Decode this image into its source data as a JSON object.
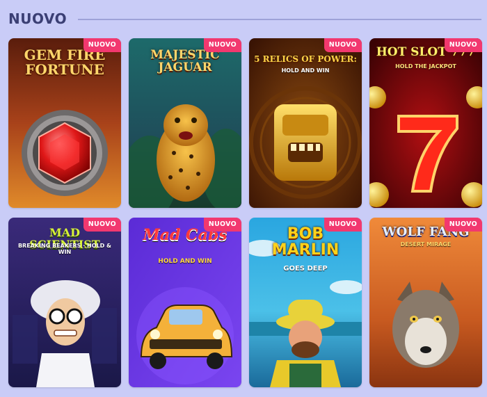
{
  "section": {
    "title": "NUOVO"
  },
  "badge_label": "NUOVO",
  "games": [
    {
      "title": "GEM FIRE FORTUNE",
      "subtitle": ""
    },
    {
      "title": "MAJESTIC JAGUAR",
      "subtitle": ""
    },
    {
      "title": "5 RELICS OF POWER:",
      "subtitle": "HOLD AND WIN"
    },
    {
      "title": "HOT SLOT 777",
      "subtitle": "HOLD THE JACKPOT"
    },
    {
      "title": "MAD SCIENTIST",
      "subtitle": "BREAKING BEAKERS · HOLD & WIN"
    },
    {
      "title": "Mad Cabs",
      "subtitle": "HOLD AND WIN"
    },
    {
      "title": "BOB MARLIN",
      "subtitle": "GOES DEEP"
    },
    {
      "title": "WOLF FANG",
      "subtitle": "DESERT MIRAGE"
    }
  ],
  "colors": {
    "background": "#c9ccf7",
    "header_text": "#3b3f74",
    "badge": "#f2386f"
  }
}
